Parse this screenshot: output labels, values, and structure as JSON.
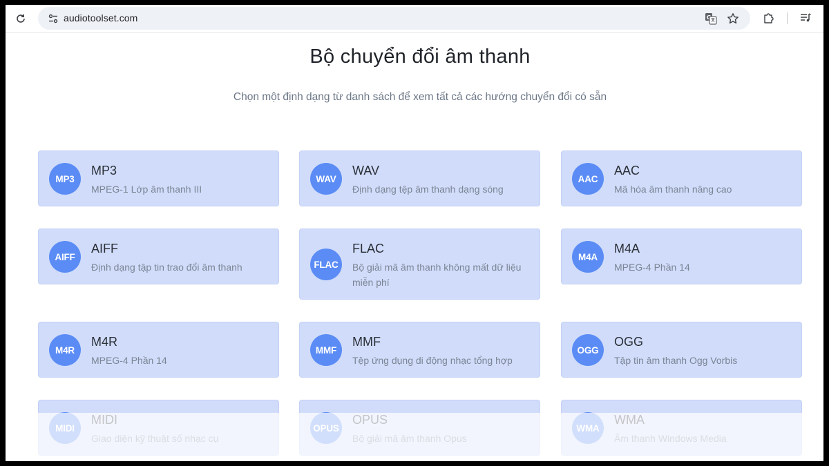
{
  "browser": {
    "url": "audiotoolset.com",
    "icons": {
      "reload": "reload-icon",
      "site_info": "tune-icon",
      "translate": "translate-icon",
      "bookmark": "star-icon",
      "extensions": "puzzle-icon",
      "media": "media-queue-icon"
    }
  },
  "page": {
    "title": "Bộ chuyển đổi âm thanh",
    "subtitle": "Chọn một định dạng từ danh sách để xem tất cả các hướng chuyển đổi có sẵn"
  },
  "formats": [
    {
      "badge": "MP3",
      "name": "MP3",
      "desc": "MPEG-1 Lớp âm thanh III"
    },
    {
      "badge": "WAV",
      "name": "WAV",
      "desc": "Định dạng tệp âm thanh dạng sóng"
    },
    {
      "badge": "AAC",
      "name": "AAC",
      "desc": "Mã hóa âm thanh nâng cao"
    },
    {
      "badge": "AIFF",
      "name": "AIFF",
      "desc": "Định dạng tập tin trao đổi âm thanh"
    },
    {
      "badge": "FLAC",
      "name": "FLAC",
      "desc": "Bộ giải mã âm thanh không mất dữ liệu miễn phí"
    },
    {
      "badge": "M4A",
      "name": "M4A",
      "desc": "MPEG-4 Phần 14"
    },
    {
      "badge": "M4R",
      "name": "M4R",
      "desc": "MPEG-4 Phần 14"
    },
    {
      "badge": "MMF",
      "name": "MMF",
      "desc": "Tệp ứng dụng di động nhạc tổng hợp"
    },
    {
      "badge": "OGG",
      "name": "OGG",
      "desc": "Tập tin âm thanh Ogg Vorbis"
    },
    {
      "badge": "MIDI",
      "name": "MIDI",
      "desc": "Giao diện kỹ thuật số nhạc cụ"
    },
    {
      "badge": "OPUS",
      "name": "OPUS",
      "desc": "Bộ giải mã âm thanh Opus"
    },
    {
      "badge": "WMA",
      "name": "WMA",
      "desc": "Âm thanh Windows Media"
    }
  ],
  "colors": {
    "card_bg": "#d0dcfa",
    "icon_bg": "#5b8cf5"
  }
}
